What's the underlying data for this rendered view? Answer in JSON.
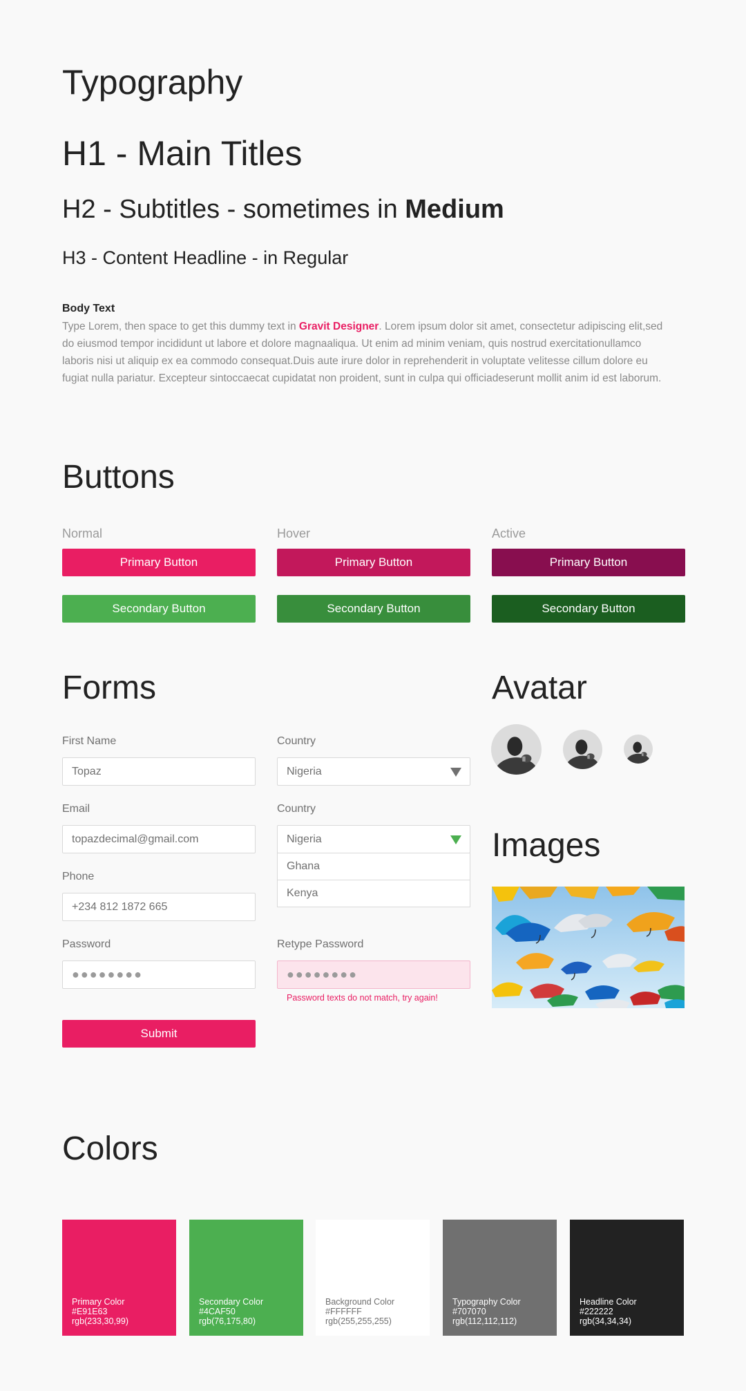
{
  "typography": {
    "title": "Typography",
    "h1": "H1 - Main Titles",
    "h2_prefix": "H2 - Subtitles - sometimes in ",
    "h2_bold": "Medium",
    "h3": "H3 - Content Headline - in Regular",
    "body_label": "Body Text",
    "body_before": "Type Lorem, then space to get this dummy text in ",
    "body_highlight": "Gravit Designer",
    "body_after": ". Lorem ipsum dolor sit amet, consectetur adipiscing elit,sed do eiusmod tempor incididunt ut labore et dolore magnaaliqua. Ut enim ad minim veniam, quis nostrud exercitationullamco laboris nisi ut aliquip ex ea commodo consequat.Duis aute irure dolor in reprehenderit in voluptate velitesse cillum dolore eu fugiat nulla pariatur. Excepteur sintoccaecat cupidatat non proident, sunt in culpa qui officiadeserunt mollit anim id est laborum."
  },
  "buttons": {
    "title": "Buttons",
    "states": [
      "Normal",
      "Hover",
      "Active"
    ],
    "primary_label": "Primary Button",
    "secondary_label": "Secondary Button",
    "primary_colors": [
      "#E91E63",
      "#C2185B",
      "#880E4F"
    ],
    "secondary_colors": [
      "#4CAF50",
      "#388E3C",
      "#1B5E20"
    ]
  },
  "forms": {
    "title": "Forms",
    "first_name": {
      "label": "First Name",
      "value": "Topaz"
    },
    "country1": {
      "label": "Country",
      "value": "Nigeria"
    },
    "email": {
      "label": "Email",
      "value": "topazdecimal@gmail.com"
    },
    "country2": {
      "label": "Country",
      "value": "Nigeria",
      "options": [
        "Ghana",
        "Kenya"
      ]
    },
    "phone": {
      "label": "Phone",
      "value": "+234 812 1872 665"
    },
    "password": {
      "label": "Password",
      "value": "●●●●●●●●"
    },
    "retype_password": {
      "label": "Retype Password",
      "value": "●●●●●●●●"
    },
    "error": "Password texts do not match, try again!",
    "submit_label": "Submit"
  },
  "avatar": {
    "title": "Avatar"
  },
  "images": {
    "title": "Images"
  },
  "colors": {
    "title": "Colors",
    "swatches": [
      {
        "name": "Primary Color",
        "hex": "#E91E63",
        "rgb": "rgb(233,30,99)"
      },
      {
        "name": "Secondary Color",
        "hex": "#4CAF50",
        "rgb": "rgb(76,175,80)"
      },
      {
        "name": "Background Color",
        "hex": "#FFFFFF",
        "rgb": "rgb(255,255,255)"
      },
      {
        "name": "Typography Color",
        "hex": "#707070",
        "rgb": "rgb(112,112,112)"
      },
      {
        "name": "Headline Color",
        "hex": "#222222",
        "rgb": "rgb(34,34,34)"
      }
    ]
  }
}
